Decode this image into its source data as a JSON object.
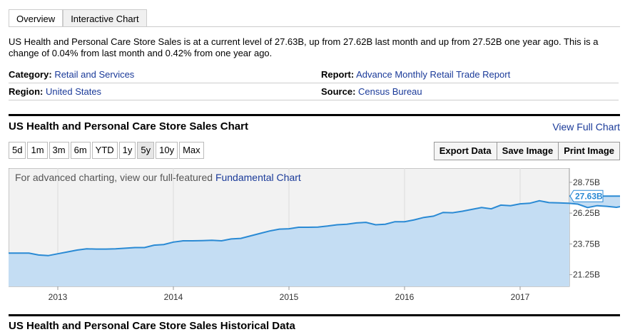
{
  "tabs": [
    {
      "label": "Overview",
      "active": true
    },
    {
      "label": "Interactive Chart",
      "active": false
    }
  ],
  "summary": "US Health and Personal Care Store Sales is at a current level of 27.63B, up from 27.62B last month and up from 27.52B one year ago. This is a change of 0.04% from last month and 0.42% from one year ago.",
  "meta": {
    "category_label": "Category:",
    "category_value": "Retail and Services",
    "report_label": "Report:",
    "report_value": "Advance Monthly Retail Trade Report",
    "region_label": "Region:",
    "region_value": "United States",
    "source_label": "Source:",
    "source_value": "Census Bureau"
  },
  "chart_section": {
    "title": "US Health and Personal Care Store Sales Chart",
    "view_full": "View Full Chart",
    "ranges": [
      "5d",
      "1m",
      "3m",
      "6m",
      "YTD",
      "1y",
      "5y",
      "10y",
      "Max"
    ],
    "active_range": "5y",
    "actions": [
      "Export Data",
      "Save Image",
      "Print Image"
    ],
    "note_prefix": "For advanced charting, view our full-featured ",
    "note_link": "Fundamental Chart"
  },
  "colors": {
    "line": "#2a8ad4",
    "fill": "#c4ddf3",
    "link": "#1a3a99"
  },
  "chart_data": {
    "type": "area",
    "title": "",
    "xlabel": "",
    "ylabel": "",
    "x_start": "2012-09",
    "x_step": "1 month",
    "x_ticks": [
      "2013",
      "2014",
      "2015",
      "2016",
      "2017"
    ],
    "y_ticks": [
      "28.75B",
      "26.25B",
      "23.75B",
      "21.25B"
    ],
    "ylim": [
      20.3,
      29.9
    ],
    "last_value_label": "27.63B",
    "values": [
      23.0,
      23.0,
      22.85,
      22.8,
      22.95,
      23.1,
      23.25,
      23.35,
      23.33,
      23.33,
      23.35,
      23.4,
      23.45,
      23.45,
      23.65,
      23.7,
      23.9,
      24.0,
      24.0,
      24.02,
      24.05,
      24.0,
      24.15,
      24.2,
      24.4,
      24.6,
      24.8,
      24.95,
      24.98,
      25.1,
      25.1,
      25.12,
      25.2,
      25.3,
      25.35,
      25.45,
      25.5,
      25.3,
      25.35,
      25.55,
      25.55,
      25.7,
      25.9,
      26.0,
      26.3,
      26.28,
      26.4,
      26.55,
      26.7,
      26.6,
      26.9,
      26.85,
      27.0,
      27.05,
      27.25,
      27.1,
      27.08,
      27.05,
      26.98,
      26.7,
      26.85,
      26.8,
      26.72,
      26.85,
      26.95,
      27.05,
      27.15,
      27.35,
      27.63
    ]
  },
  "historical_title": "US Health and Personal Care Store Sales Historical Data"
}
